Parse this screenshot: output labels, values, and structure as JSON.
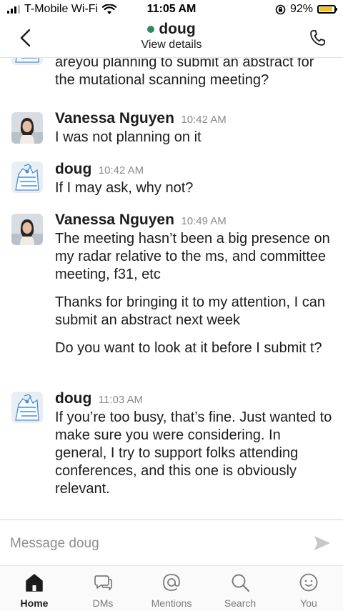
{
  "status_bar": {
    "carrier": "T-Mobile Wi-Fi",
    "time": "11:05 AM",
    "battery_percent": "92%",
    "battery_level": 0.92
  },
  "header": {
    "title": "doug",
    "subtitle": "View details",
    "presence_color": "#2b8a5b"
  },
  "messages": [
    {
      "sender": "",
      "time": "",
      "avatar": "doug-avatar",
      "texts": [
        "areyou planning to submit an abstract for the mutational scanning meeting?"
      ]
    },
    {
      "sender": "Vanessa Nguyen",
      "time": "10:42 AM",
      "avatar": "vanessa-avatar",
      "texts": [
        "I was not planning on it"
      ]
    },
    {
      "sender": "doug",
      "time": "10:42 AM",
      "avatar": "doug-avatar",
      "texts": [
        "If I may ask, why not?"
      ]
    },
    {
      "sender": "Vanessa Nguyen",
      "time": "10:49 AM",
      "avatar": "vanessa-avatar",
      "texts": [
        "The meeting hasn’t been a big presence on my radar relative to the ms, and committee meeting, f31, etc",
        "Thanks for bringing it to my attention, I can submit an abstract next week",
        "Do you want to look at it before I submit t?"
      ]
    },
    {
      "sender": "doug",
      "time": "11:03 AM",
      "avatar": "doug-avatar",
      "texts": [
        "If you’re too busy, that’s fine.  Just wanted to make sure you were considering.  In general, I try to support folks attending conferences, and this one is obviously relevant."
      ]
    }
  ],
  "composer": {
    "placeholder": "Message doug"
  },
  "tabs": [
    {
      "label": "Home",
      "icon": "home-icon",
      "active": true
    },
    {
      "label": "DMs",
      "icon": "dms-icon",
      "active": false
    },
    {
      "label": "Mentions",
      "icon": "mentions-icon",
      "active": false
    },
    {
      "label": "Search",
      "icon": "search-icon",
      "active": false
    },
    {
      "label": "You",
      "icon": "you-icon",
      "active": false
    }
  ],
  "colors": {
    "text": "#1d1c1d",
    "muted": "#8b8b8b",
    "battery": "#f3c316"
  }
}
